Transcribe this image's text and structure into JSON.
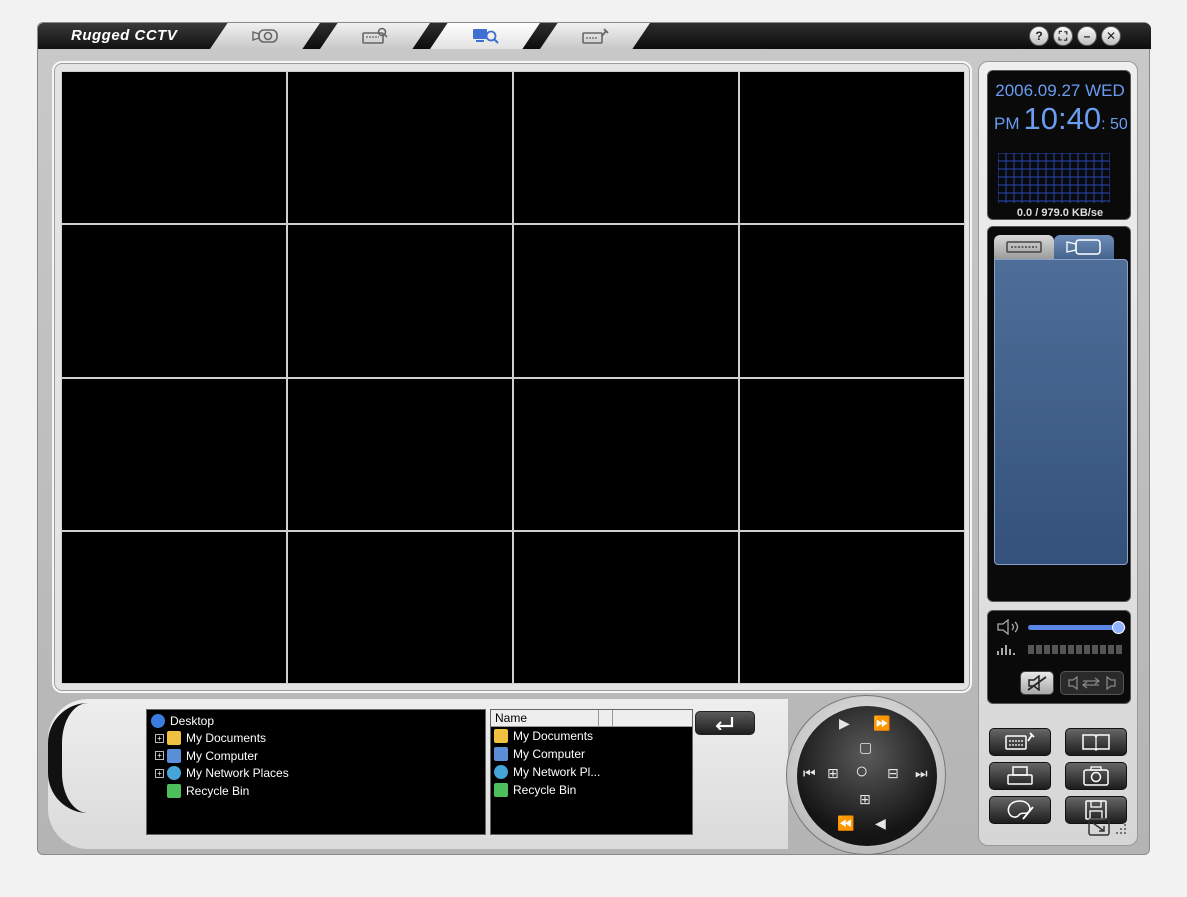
{
  "window": {
    "app_title": "Rugged CCTV",
    "tabs": [
      {
        "icon": "camera-icon",
        "active": false
      },
      {
        "icon": "search-keyboard-icon",
        "active": false
      },
      {
        "icon": "network-search-icon",
        "active": true
      },
      {
        "icon": "settings-device-icon",
        "active": false
      }
    ],
    "controls": {
      "help": "?",
      "fullscreen": "⛶",
      "minimize": "–",
      "close": "✕"
    }
  },
  "video_grid": {
    "rows": 4,
    "columns": 4,
    "cell_color": "#000000"
  },
  "folder_tree": {
    "root": "Desktop",
    "items": [
      {
        "label": "My Documents",
        "icon": "folder-icon",
        "expandable": true
      },
      {
        "label": "My Computer",
        "icon": "computer-icon",
        "expandable": true
      },
      {
        "label": "My Network Places",
        "icon": "network-icon",
        "expandable": true
      },
      {
        "label": "Recycle Bin",
        "icon": "recycle-bin-icon",
        "expandable": false
      }
    ]
  },
  "file_list": {
    "header": "Name",
    "items": [
      {
        "label": "My Documents",
        "icon": "folder-icon"
      },
      {
        "label": "My Computer",
        "icon": "computer-icon"
      },
      {
        "label": "My Network Pl...",
        "icon": "network-icon"
      },
      {
        "label": "Recycle Bin",
        "icon": "recycle-bin-icon"
      }
    ]
  },
  "clock": {
    "date": "2006.09.27 WED",
    "ampm": "PM",
    "hour_minute": "10:40",
    "seconds": ": 50",
    "network_rate": "0.0 / 979.0 KB/se"
  },
  "audio": {
    "volume": 0.92,
    "muted": false
  },
  "colors": {
    "accent": "#6a9cf0",
    "panel_blue": "#3d5e8a",
    "frame": "#c4c4c4"
  }
}
